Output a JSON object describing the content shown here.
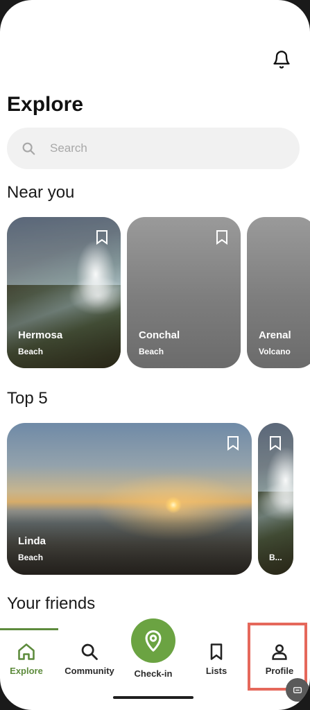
{
  "page": {
    "title": "Explore"
  },
  "search": {
    "placeholder": "Search"
  },
  "near_you": {
    "title": "Near you",
    "cards": [
      {
        "name": "Hermosa",
        "type": "Beach"
      },
      {
        "name": "Conchal",
        "type": "Beach"
      },
      {
        "name": "Arenal",
        "type": "Volcano"
      }
    ]
  },
  "top5": {
    "title": "Top 5",
    "cards": [
      {
        "name": "Linda",
        "type": "Beach"
      },
      {
        "name": "",
        "type": "B..."
      }
    ]
  },
  "friends": {
    "title": "Your friends"
  },
  "nav": {
    "items": [
      {
        "label": "Explore",
        "icon": "home-icon",
        "active": true
      },
      {
        "label": "Community",
        "icon": "search-icon"
      },
      {
        "label": "Check-in",
        "icon": "location-pin-icon"
      },
      {
        "label": "Lists",
        "icon": "bookmark-icon"
      },
      {
        "label": "Profile",
        "icon": "person-icon"
      }
    ]
  },
  "colors": {
    "accent": "#6ba342",
    "active_nav": "#5d8b3c",
    "highlight": "#e5685b"
  }
}
